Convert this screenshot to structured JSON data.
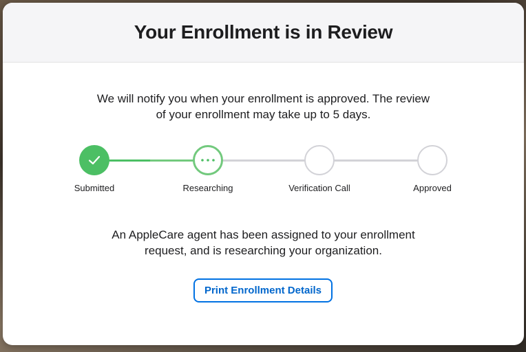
{
  "modal": {
    "title": "Your Enrollment is in Review",
    "intro_line1": "We will notify you when your enrollment is approved. The review",
    "intro_line2": "of your enrollment may take up to 5 days.",
    "status_line1": "An AppleCare agent has been assigned to your enrollment",
    "status_line2": "request, and is researching your organization.",
    "print_button_label": "Print Enrollment Details"
  },
  "progress": {
    "steps": [
      {
        "label": "Submitted",
        "state": "complete",
        "icon": "checkmark-icon"
      },
      {
        "label": "Researching",
        "state": "in-progress",
        "icon": "ellipsis-icon"
      },
      {
        "label": "Verification Call",
        "state": "pending",
        "icon": "empty-circle-icon"
      },
      {
        "label": "Approved",
        "state": "pending",
        "icon": "empty-circle-icon"
      }
    ]
  },
  "colors": {
    "complete": "#4cbf64",
    "in_progress": "#72c97d",
    "pending": "#d2d2d7",
    "accent": "#0071e3",
    "text": "#1d1d1f",
    "header_bg": "#f5f5f7"
  }
}
